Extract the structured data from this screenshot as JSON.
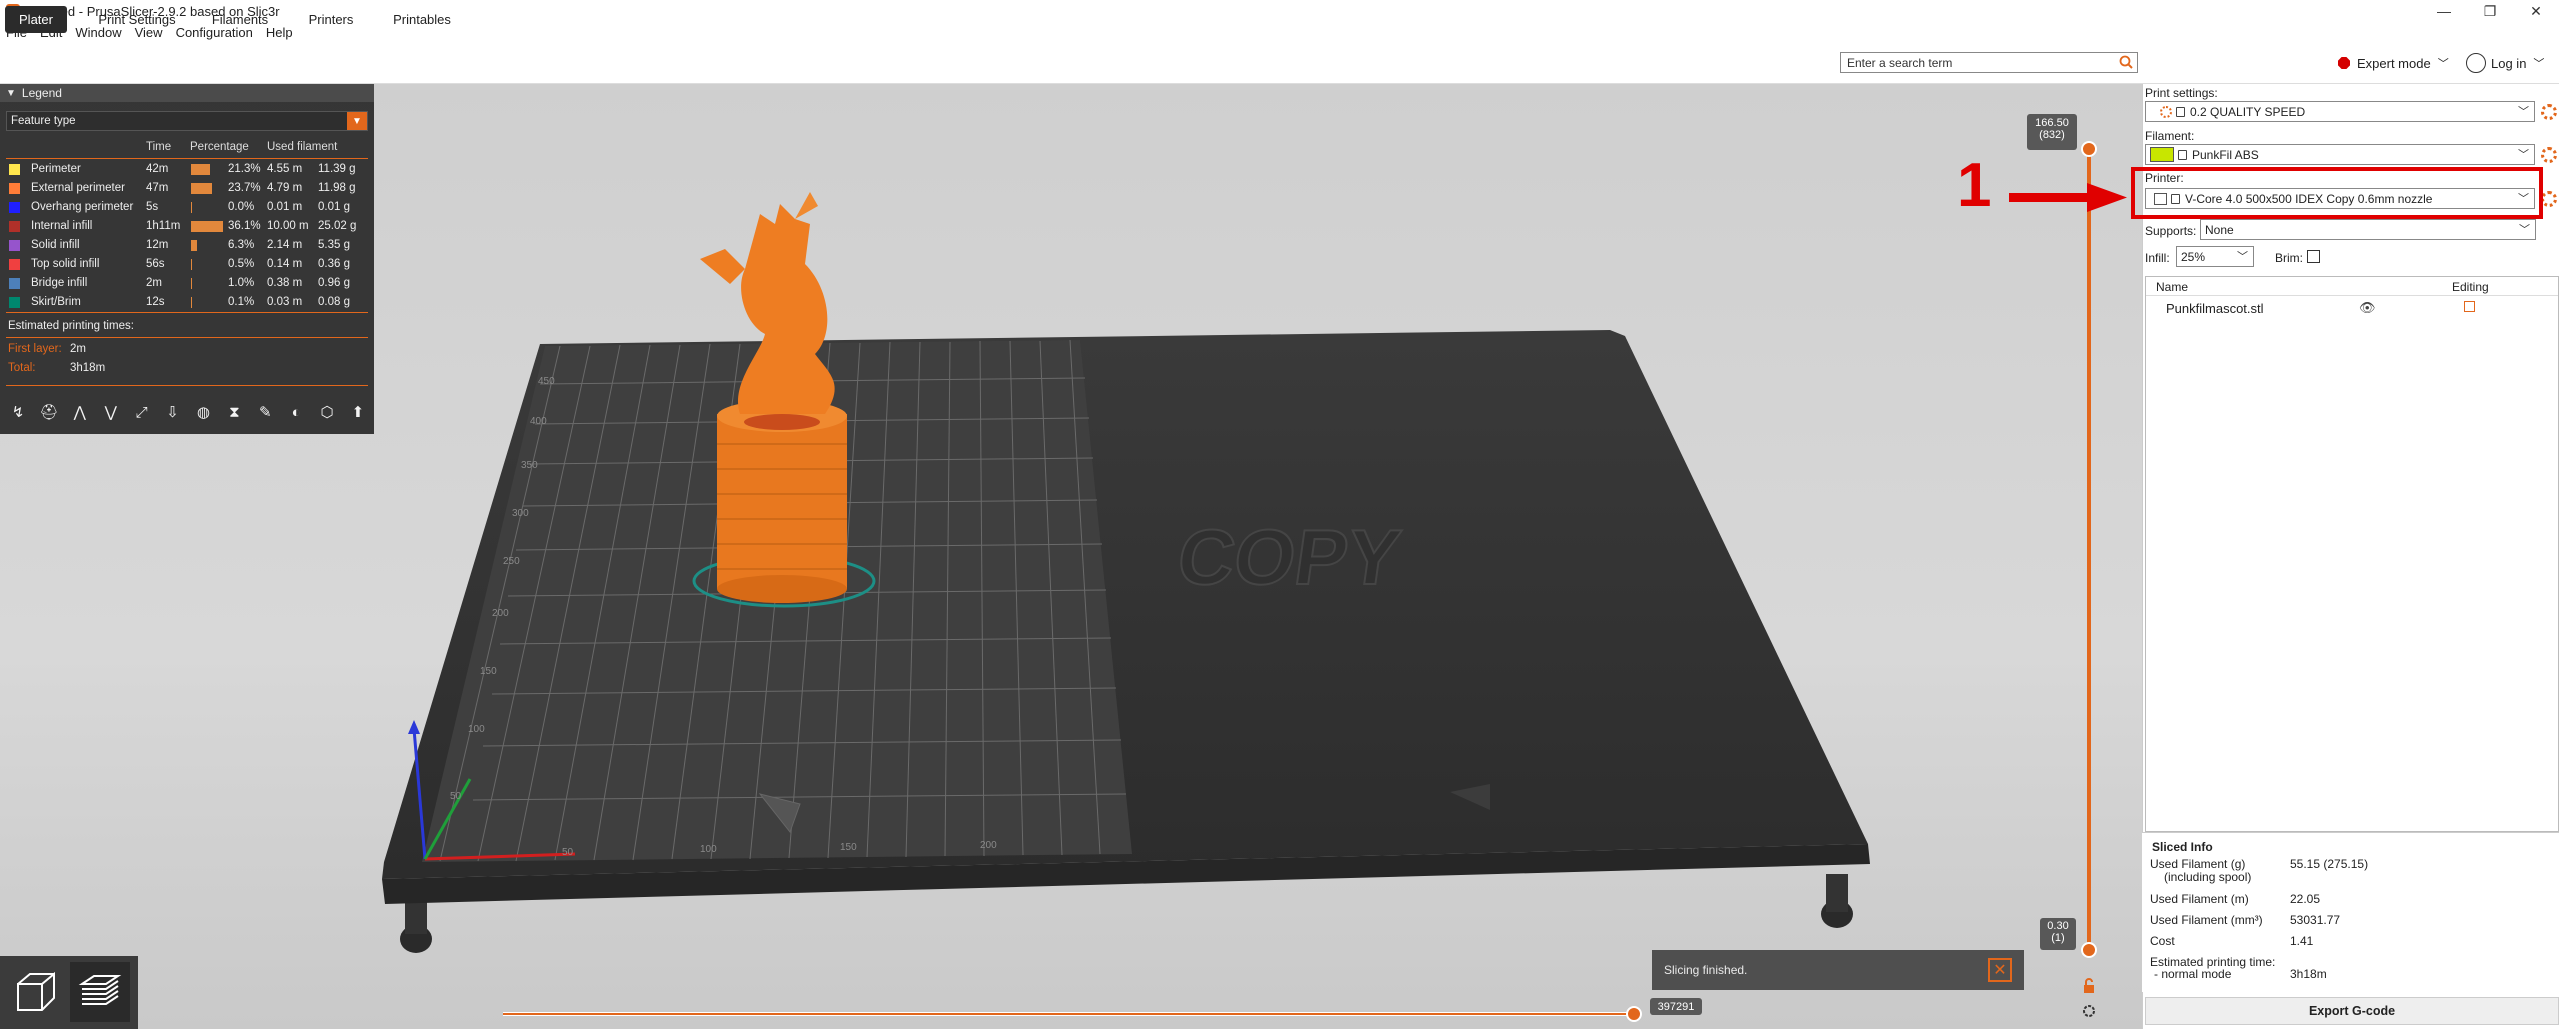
{
  "window": {
    "title": "*Untitled - PrusaSlicer-2.9.2 based on Slic3r",
    "controls": [
      "—",
      "❐",
      "✕"
    ]
  },
  "menu": [
    "File",
    "Edit",
    "Window",
    "View",
    "Configuration",
    "Help"
  ],
  "tabs": [
    "Plater",
    "Print Settings",
    "Filaments",
    "Printers",
    "Printables"
  ],
  "search": {
    "placeholder": "Enter a search term"
  },
  "mode": {
    "label": "Expert mode",
    "color": "#d40000"
  },
  "login": {
    "label": "Log in"
  },
  "legend": {
    "title": "Legend",
    "view_type": "Feature type",
    "columns": [
      "Time",
      "Percentage",
      "Used filament"
    ],
    "rows": [
      {
        "name": "Perimeter",
        "color": "#ffe64d",
        "time": "42m",
        "pct": "21.3%",
        "pct_value": 21.3,
        "len": "4.55 m",
        "weight": "11.39 g"
      },
      {
        "name": "External perimeter",
        "color": "#ff7d38",
        "time": "47m",
        "pct": "23.7%",
        "pct_value": 23.7,
        "len": "4.79 m",
        "weight": "11.98 g"
      },
      {
        "name": "Overhang perimeter",
        "color": "#1f1fff",
        "time": "5s",
        "pct": "0.0%",
        "pct_value": 0.0,
        "len": "0.01 m",
        "weight": "0.01 g"
      },
      {
        "name": "Internal infill",
        "color": "#b03029",
        "time": "1h11m",
        "pct": "36.1%",
        "pct_value": 36.1,
        "len": "10.00 m",
        "weight": "25.02 g"
      },
      {
        "name": "Solid infill",
        "color": "#9654cc",
        "time": "12m",
        "pct": "6.3%",
        "pct_value": 6.3,
        "len": "2.14 m",
        "weight": "5.35 g"
      },
      {
        "name": "Top solid infill",
        "color": "#f04040",
        "time": "56s",
        "pct": "0.5%",
        "pct_value": 0.5,
        "len": "0.14 m",
        "weight": "0.36 g"
      },
      {
        "name": "Bridge infill",
        "color": "#4d80ba",
        "time": "2m",
        "pct": "1.0%",
        "pct_value": 1.0,
        "len": "0.38 m",
        "weight": "0.96 g"
      },
      {
        "name": "Skirt/Brim",
        "color": "#00876e",
        "time": "12s",
        "pct": "0.1%",
        "pct_value": 0.1,
        "len": "0.03 m",
        "weight": "0.08 g"
      }
    ],
    "estimated_label": "Estimated printing times:",
    "first_layer_label": "First layer:",
    "first_layer_value": "2m",
    "total_label": "Total:",
    "total_value": "3h18m"
  },
  "bed_labels": {
    "x": [
      "50",
      "100",
      "150",
      "200"
    ],
    "y": [
      "50",
      "100",
      "150",
      "200",
      "250",
      "300",
      "350",
      "400",
      "450"
    ],
    "embossed": "COPY"
  },
  "vertical_slider": {
    "top": "166.50",
    "top_sub": "(832)",
    "bottom": "0.30",
    "bottom_sub": "(1)"
  },
  "horizontal_slider": {
    "value": "397291"
  },
  "notification": {
    "text": "Slicing finished."
  },
  "sidebar": {
    "print_settings_label": "Print settings:",
    "print_settings_value": "0.2 QUALITY SPEED",
    "filament_label": "Filament:",
    "filament_value": "PunkFil ABS",
    "filament_color": "#c8e600",
    "printer_label": "Printer:",
    "printer_value": "V-Core 4.0 500x500 IDEX Copy 0.6mm nozzle",
    "supports_label": "Supports:",
    "supports_value": "None",
    "infill_label": "Infill:",
    "infill_value": "25%",
    "brim_label": "Brim:",
    "list_col_name": "Name",
    "list_col_editing": "Editing",
    "object_name": "Punkfilmascot.stl"
  },
  "sliced_info": {
    "title": "Sliced Info",
    "rows": [
      {
        "label": "Used Filament (g)",
        "value": "55.15 (275.15)"
      },
      {
        "label": "(including spool)",
        "value": ""
      },
      {
        "label": "Used Filament (m)",
        "value": "22.05"
      },
      {
        "label": "Used Filament (mm³)",
        "value": "53031.77"
      },
      {
        "label": "Cost",
        "value": "1.41"
      },
      {
        "label": "Estimated printing time:",
        "value": ""
      },
      {
        "label": "- normal mode",
        "value": "3h18m"
      }
    ]
  },
  "export_button": "Export G-code",
  "annotation": {
    "number": "1",
    "color": "#e00000"
  }
}
